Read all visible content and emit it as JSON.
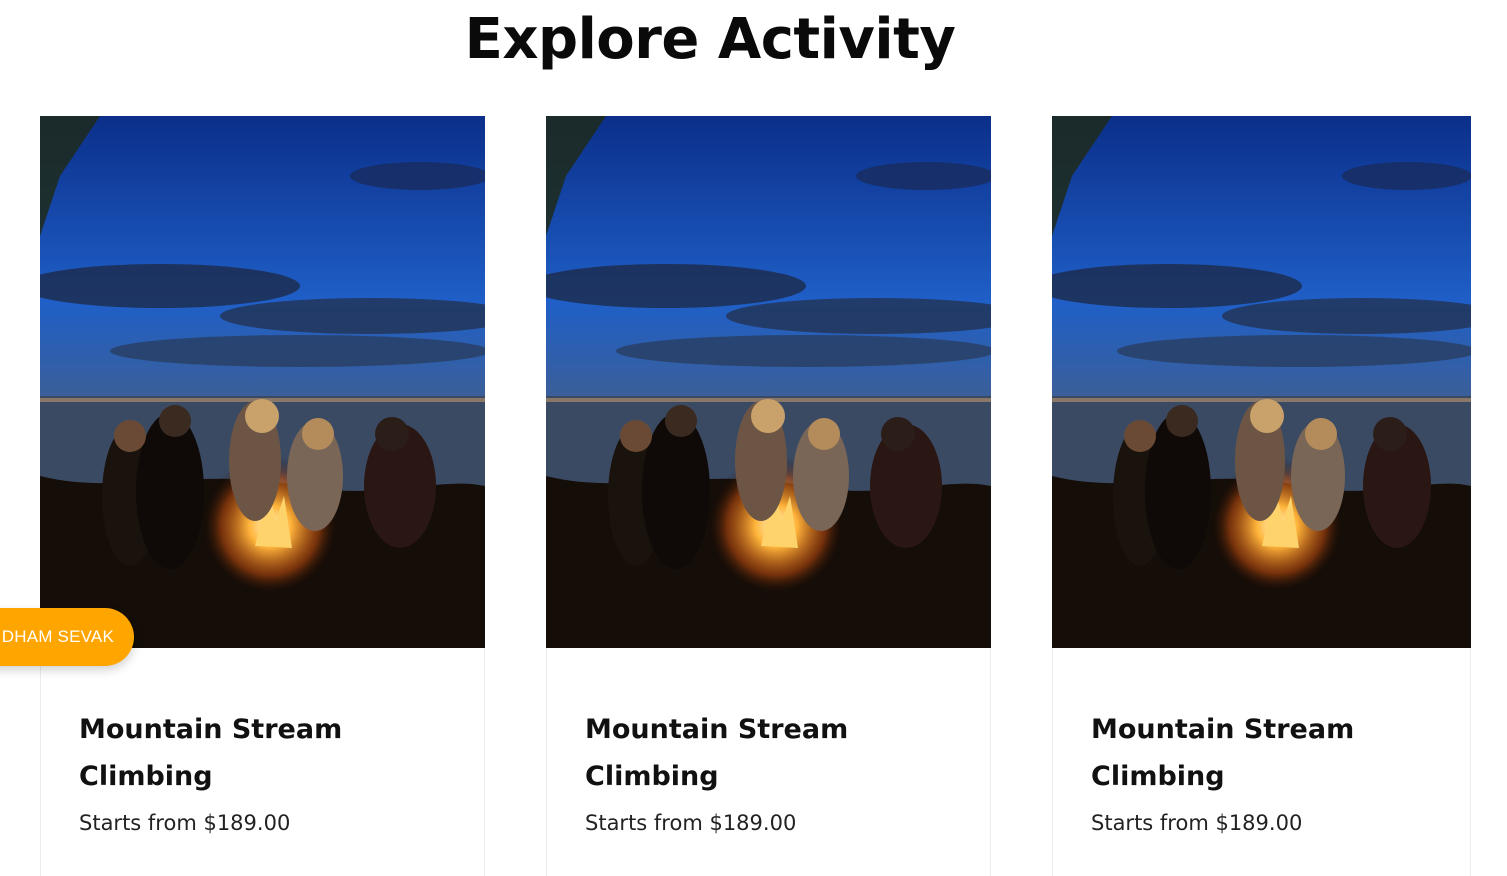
{
  "section": {
    "title": "Explore Activity"
  },
  "cards": [
    {
      "title": "Mountain Stream Climbing",
      "price": "Starts from $189.00",
      "image": "campfire-by-lake-photo"
    },
    {
      "title": "Mountain Stream Climbing",
      "price": "Starts from $189.00",
      "image": "campfire-by-lake-photo"
    },
    {
      "title": "Mountain Stream Climbing",
      "price": "Starts from $189.00",
      "image": "campfire-by-lake-photo"
    }
  ],
  "floating_badge": {
    "label": "DHAM SEVAK",
    "color": "#ffa500"
  },
  "colors": {
    "title": "#0a0a0a",
    "text": "#111111",
    "card_border": "#ececec"
  }
}
